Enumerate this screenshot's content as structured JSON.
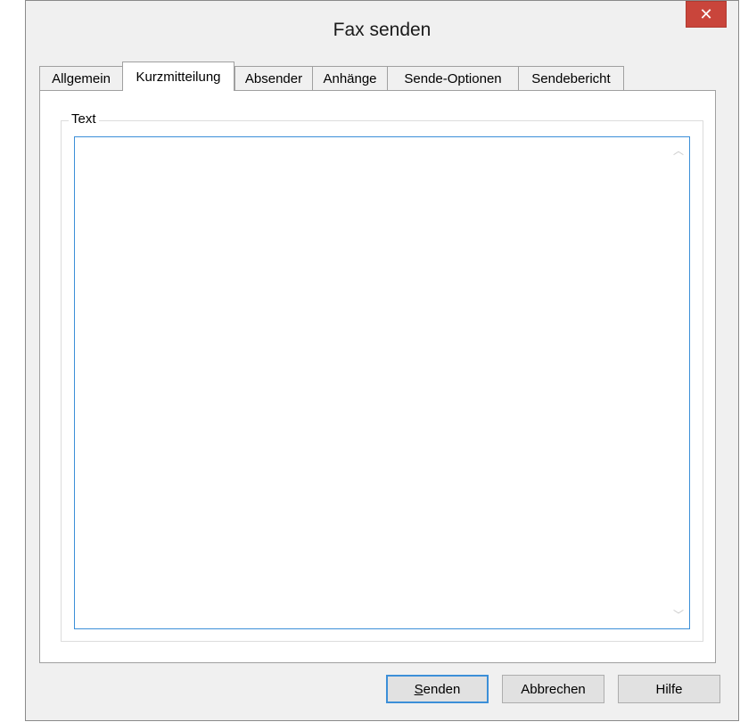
{
  "window": {
    "title": "Fax senden"
  },
  "tabs": [
    {
      "label": "Allgemein"
    },
    {
      "label": "Kurzmitteilung",
      "active": true
    },
    {
      "label": "Absender"
    },
    {
      "label": "Anhänge"
    },
    {
      "label": "Sende-Optionen"
    },
    {
      "label": "Sendebericht"
    }
  ],
  "panel": {
    "group_label": "Text",
    "text_value": ""
  },
  "buttons": {
    "send": "Senden",
    "cancel": "Abbrechen",
    "help": "Hilfe"
  },
  "icons": {
    "close": "close-icon",
    "scroll_up": "chevron-up-icon",
    "scroll_down": "chevron-down-icon"
  },
  "colors": {
    "close_button": "#c9453b",
    "focus_border": "#3c8fd8",
    "dialog_bg": "#f0f0f0"
  }
}
